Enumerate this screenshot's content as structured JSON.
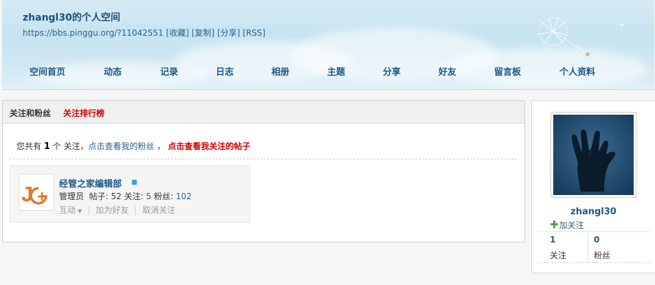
{
  "header": {
    "title": "zhangl30的个人空间",
    "url": "https://bbs.pinggu.org/?11042551",
    "actions": [
      "[收藏]",
      "[复制]",
      "[分享]",
      "[RSS]"
    ],
    "nav": [
      "空间首页",
      "动态",
      "记录",
      "日志",
      "相册",
      "主题",
      "分享",
      "好友",
      "留言板",
      "个人资料"
    ]
  },
  "main": {
    "title": "关注和粉丝",
    "rank_link": "关注排行榜",
    "summary": {
      "prefix": "您共有",
      "count": "1",
      "unit": "个 关注，",
      "fans_link": "点击查看我的粉丝",
      "comma": "，",
      "posts_link": "点击查看我关注的帖子"
    },
    "follow_card": {
      "name": "经管之家编辑部",
      "role": "管理员",
      "posts_label": "帖子:",
      "posts": "52",
      "following_label": "关注:",
      "following": "5",
      "fans_label": "粉丝:",
      "fans": "102",
      "actions": [
        "互动",
        "加为好友",
        "取消关注"
      ]
    }
  },
  "sidebar": {
    "username": "zhangl30",
    "follow_button": "加关注",
    "stats": [
      {
        "value": "1",
        "label": "关注"
      },
      {
        "value": "0",
        "label": "粉丝"
      }
    ]
  }
}
